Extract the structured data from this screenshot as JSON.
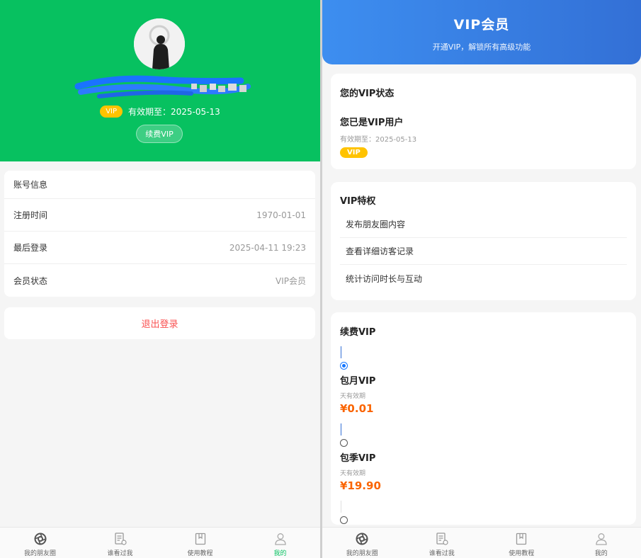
{
  "profile": {
    "vip_badge": "VIP",
    "expiry": "有效期至：2025-05-13",
    "renew_button": "续费VIP"
  },
  "account": {
    "title": "账号信息",
    "rows": [
      {
        "label": "注册时间",
        "value": "1970-01-01"
      },
      {
        "label": "最后登录",
        "value": "2025-04-11 19:23"
      },
      {
        "label": "会员状态",
        "value": "VIP会员"
      }
    ]
  },
  "logout_label": "退出登录",
  "tabbar": [
    {
      "label": "我的朋友圈",
      "icon": "moments-icon"
    },
    {
      "label": "谁看过我",
      "icon": "visitor-icon"
    },
    {
      "label": "使用教程",
      "icon": "bookmark-icon"
    },
    {
      "label": "我的",
      "icon": "user-icon"
    }
  ],
  "vip_page": {
    "title": "VIP会员",
    "subtitle": "开通VIP，解锁所有高级功能",
    "status": {
      "title": "您的VIP状态",
      "main": "您已是VIP用户",
      "expiry": "有效期至：2025-05-13",
      "badge": "VIP"
    },
    "privileges": {
      "title": "VIP特权",
      "items": [
        "发布朋友圈内容",
        "查看详细访客记录",
        "统计访问时长与互动"
      ]
    },
    "renew": {
      "title": "续费VIP",
      "plans": [
        {
          "name": "包月VIP",
          "validity": "天有效期",
          "price": "¥0.01",
          "selected": true
        },
        {
          "name": "包季VIP",
          "validity": "天有效期",
          "price": "¥19.90",
          "selected": false
        }
      ]
    }
  },
  "colors": {
    "wechat_green": "#07c160",
    "vip_blue": "#3370d6",
    "vip_gold": "#ffc300",
    "price_orange": "#fa6400",
    "logout_red": "#fa5151"
  }
}
